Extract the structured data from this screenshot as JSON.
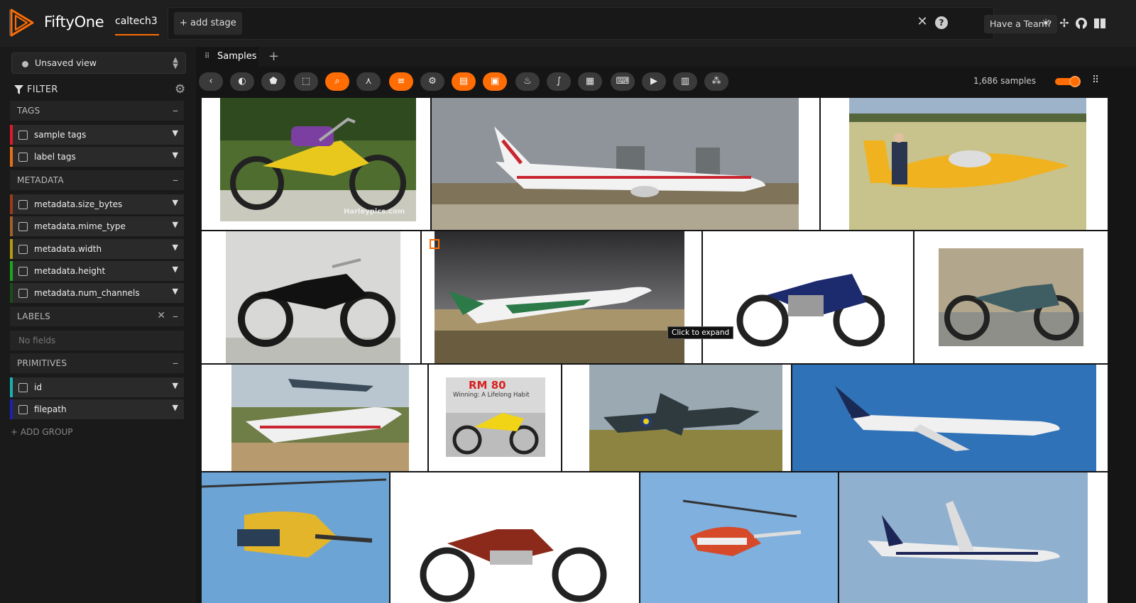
{
  "header": {
    "brand": "FiftyOne",
    "dataset": "caltech3",
    "add_stage": "+ add stage",
    "team_button": "Have a Team?",
    "icons": [
      "sun-icon",
      "slack-icon",
      "github-icon",
      "docs-icon"
    ]
  },
  "sidebar": {
    "view_select": "Unsaved view",
    "filter_title": "FILTER",
    "groups": {
      "tags": "TAGS",
      "metadata": "METADATA",
      "labels": "LABELS",
      "primitives": "PRIMITIVES"
    },
    "fields": {
      "sample_tags": "sample tags",
      "label_tags": "label tags",
      "size_bytes": "metadata.size_bytes",
      "mime_type": "metadata.mime_type",
      "width": "metadata.width",
      "height": "metadata.height",
      "num_channels": "metadata.num_channels",
      "id": "id",
      "filepath": "filepath"
    },
    "no_fields": "No fields",
    "add_group": "+ ADD GROUP",
    "colors": {
      "sample_tags": "#e0192b",
      "label_tags": "#e86f1c",
      "size_bytes": "#9c3b1c",
      "mime_type": "#a0632a",
      "width": "#b59c0e",
      "height": "#1ea51e",
      "num_channels": "#1a4d1a",
      "id": "#1ab0b0",
      "filepath": "#1f1fb8"
    }
  },
  "tabs": {
    "samples": "Samples"
  },
  "toolbar": {
    "count": "1,686 samples",
    "tooltip": "Click to expand"
  },
  "gallery_captions": {
    "harley": "Harleypics.com",
    "rm80_title": "RM 80",
    "rm80_sub": "Winning: A Lifelong Habit"
  }
}
